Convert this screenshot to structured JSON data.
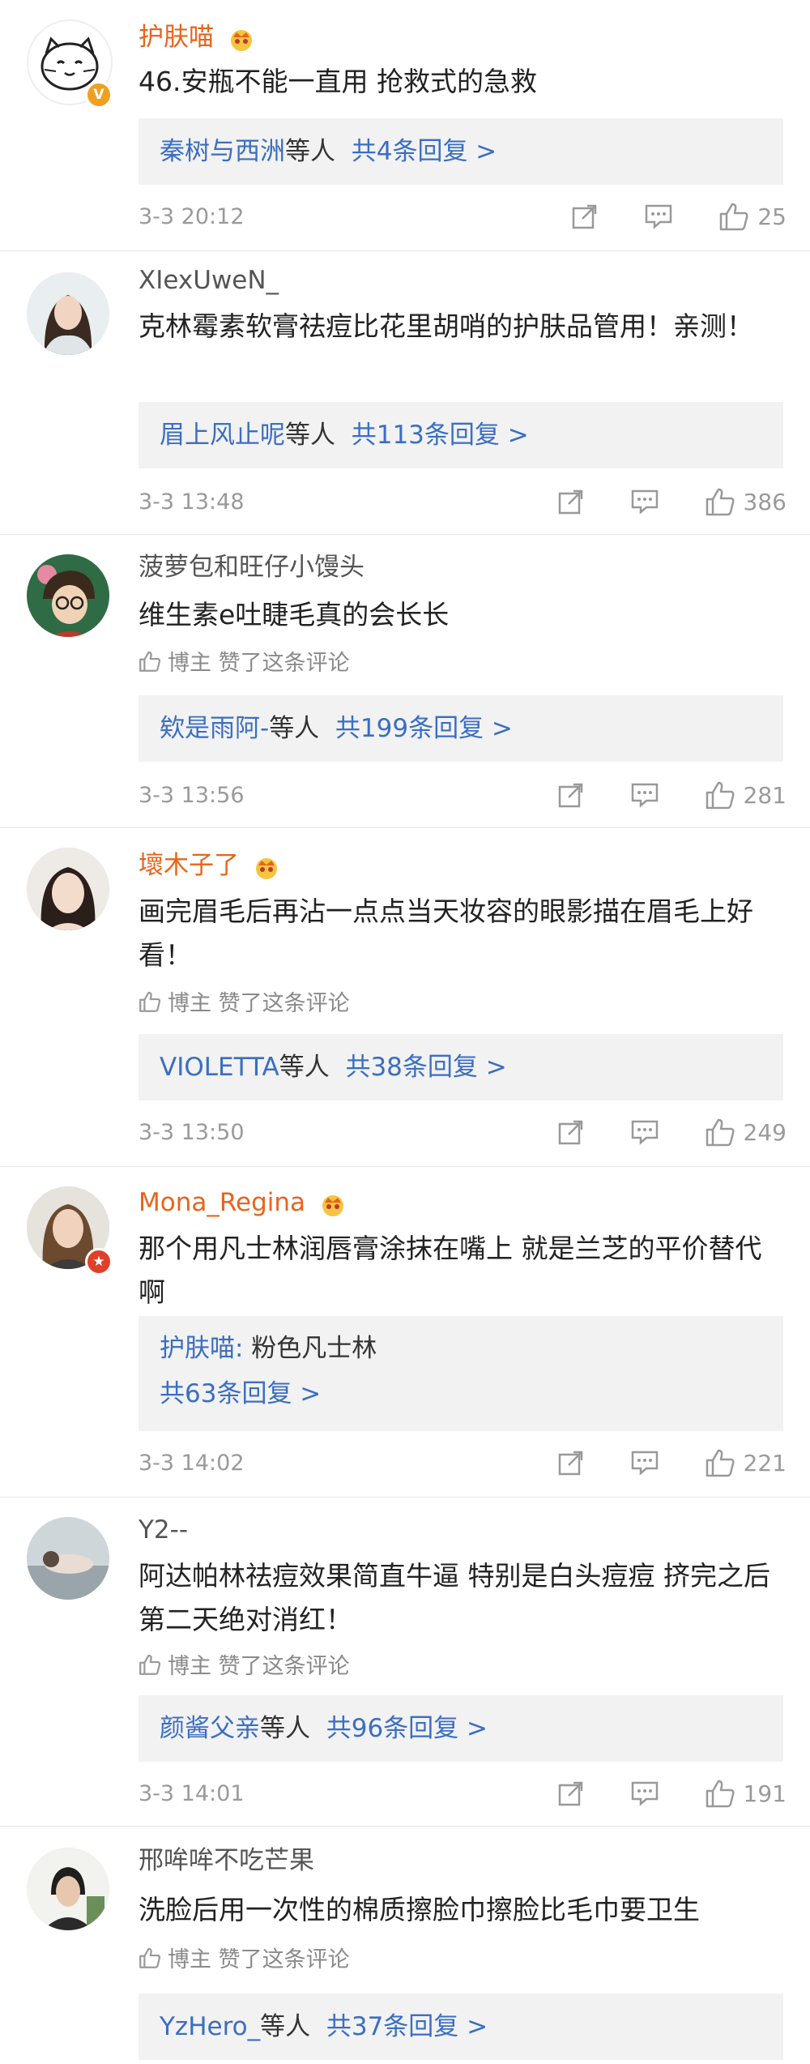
{
  "comments": [
    {
      "user": "护肤喵",
      "vip": true,
      "badge": "V",
      "badge_color": "#f0a020",
      "text": "46.安瓶不能一直用 抢救式的急救",
      "liked_by_author": "",
      "reply_name": "秦树与西洲",
      "reply_suffix": "等人",
      "reply_link": "共4条回复 >",
      "time": "3-3 20:12",
      "likes": "25"
    },
    {
      "user": "XIexUweN_",
      "vip": false,
      "text": "克林霉素软膏祛痘比花里胡哨的护肤品管用！亲测！",
      "liked_by_author": "",
      "reply_name": "眉上风止呢",
      "reply_suffix": "等人",
      "reply_link": "共113条回复 >",
      "time": "3-3 13:48",
      "likes": "386"
    },
    {
      "user": "菠萝包和旺仔小馒头",
      "vip": false,
      "text": "维生素e吐睫毛真的会长长",
      "liked_by_author": "博主 赞了这条评论",
      "reply_name": "欸是雨阿-",
      "reply_suffix": "等人",
      "reply_link": "共199条回复 >",
      "time": "3-3 13:56",
      "likes": "281"
    },
    {
      "user": "壞木子了",
      "vip": true,
      "text": "画完眉毛后再沾一点点当天妆容的眼影描在眉毛上好看！",
      "liked_by_author": "博主 赞了这条评论",
      "reply_name": "VIOLETTA",
      "reply_suffix": "等人",
      "reply_link": "共38条回复 >",
      "time": "3-3 13:50",
      "likes": "249"
    },
    {
      "user": "Mona_Regina",
      "vip": true,
      "badge": "★",
      "badge_color": "#e0402a",
      "text": "那个用凡士林润唇膏涂抹在嘴上 就是兰芝的平价替代啊",
      "liked_by_author": "",
      "reply_quote_name": "护肤喵:",
      "reply_quote_text": " 粉色凡士林",
      "reply_name": "",
      "reply_suffix": "",
      "reply_link": "共63条回复 >",
      "time": "3-3 14:02",
      "likes": "221"
    },
    {
      "user": "Y2--",
      "vip": false,
      "text": "阿达帕林祛痘效果简直牛逼 特别是白头痘痘 挤完之后第二天绝对消红！",
      "liked_by_author": "博主 赞了这条评论",
      "reply_name": "颜酱父亲",
      "reply_suffix": "等人",
      "reply_link": "共96条回复 >",
      "time": "3-3 14:01",
      "likes": "191"
    },
    {
      "user": "邢哞哞不吃芒果",
      "vip": false,
      "text": "洗脸后用一次性的棉质擦脸巾擦脸比毛巾要卫生",
      "liked_by_author": "博主 赞了这条评论",
      "reply_name": "YzHero_",
      "reply_suffix": "等人",
      "reply_link": "共37条回复 >",
      "time": "",
      "likes": ""
    }
  ],
  "colors": {
    "vip_name": "#e8641b",
    "link": "#3b6ec2",
    "meta": "#9a9a9a"
  },
  "icons": [
    "share-icon",
    "comment-icon",
    "like-icon",
    "crown-icon",
    "verified-badge-icon"
  ]
}
